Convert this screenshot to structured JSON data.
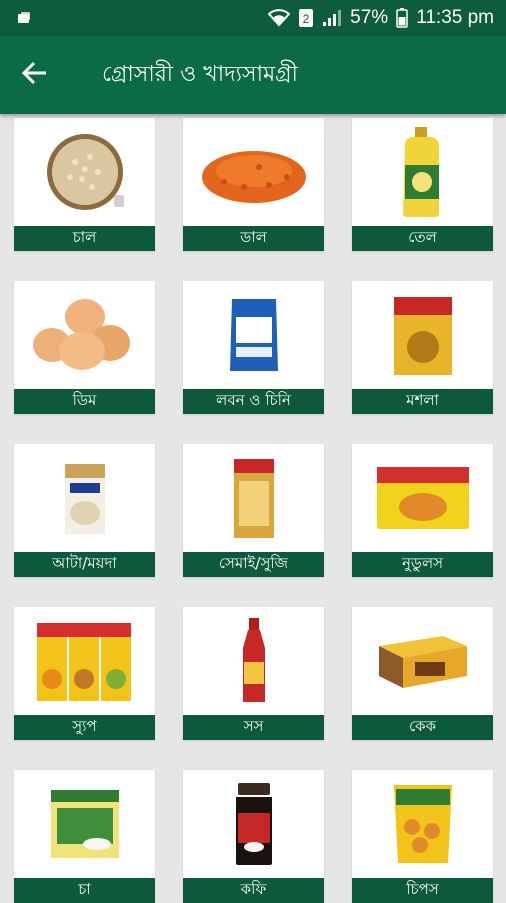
{
  "status_bar": {
    "time": "11:35 pm",
    "battery_percent": "57%",
    "sim_label": "2"
  },
  "app_bar": {
    "title": "গ্রোসারী ও খাদ্যসামগ্রী"
  },
  "categories": [
    {
      "label": "চাল",
      "icon": "rice-icon"
    },
    {
      "label": "ডাল",
      "icon": "lentil-icon"
    },
    {
      "label": "তেল",
      "icon": "oil-bottle-icon"
    },
    {
      "label": "ডিম",
      "icon": "eggs-icon"
    },
    {
      "label": "লবন ও চিনি",
      "icon": "salt-pack-icon"
    },
    {
      "label": "মশলা",
      "icon": "spice-pack-icon"
    },
    {
      "label": "আটা/ময়দা",
      "icon": "flour-pack-icon"
    },
    {
      "label": "সেমাই/সুজি",
      "icon": "semai-pack-icon"
    },
    {
      "label": "নুডুলস",
      "icon": "noodles-pack-icon"
    },
    {
      "label": "স্যুপ",
      "icon": "soup-packs-icon"
    },
    {
      "label": "সস",
      "icon": "sauce-bottle-icon"
    },
    {
      "label": "কেক",
      "icon": "cake-box-icon"
    },
    {
      "label": "চা",
      "icon": "tea-pack-icon"
    },
    {
      "label": "কফি",
      "icon": "coffee-jar-icon"
    },
    {
      "label": "চিপস",
      "icon": "chips-pack-icon"
    }
  ],
  "colors": {
    "status_bar": "#0d5c3d",
    "app_bar": "#0b6b45",
    "label_bg": "#0c5a3b",
    "background": "#e6e6e6"
  }
}
